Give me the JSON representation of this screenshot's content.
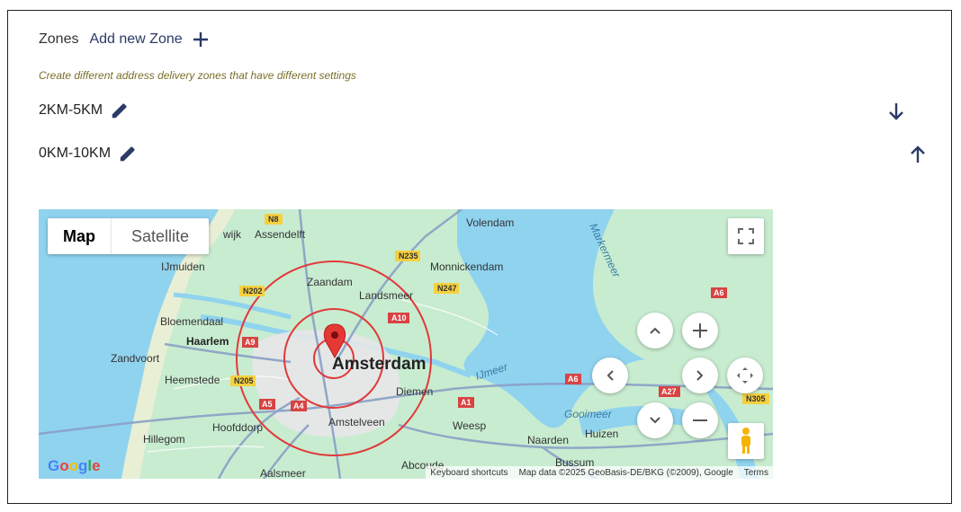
{
  "zones": {
    "title": "Zones",
    "add_label": "Add new Zone",
    "hint": "Create different address delivery zones that have different settings",
    "items": [
      {
        "name": "2KM-5KM",
        "arrow": "arrow-down-icon"
      },
      {
        "name": "0KM-10KM",
        "arrow": "arrow-up-icon"
      }
    ]
  },
  "map": {
    "type_control": {
      "map_label": "Map",
      "satellite_label": "Satellite",
      "selected": "Map"
    },
    "city_label": "Amsterdam",
    "place_labels": [
      "Assendelft",
      "Volendam",
      "IJmuiden",
      "Zaandam",
      "Monnickendam",
      "Landsmeer",
      "Bloemendaal",
      "Haarlem",
      "Zandvoort",
      "Heemstede",
      "Diemen",
      "Amstelveen",
      "Weesp",
      "Hoofddorp",
      "Hillegom",
      "Naarden",
      "Huizen",
      "Abcoude",
      "Bussum",
      "Aalsmeer",
      "IJmeer",
      "Gooimeer",
      "Markermeer",
      "wijk"
    ],
    "road_badges": [
      "N8",
      "N235",
      "N202",
      "N247",
      "A10",
      "A9",
      "N205",
      "A5",
      "A4",
      "A1",
      "A6",
      "A27",
      "N305",
      "A6"
    ],
    "attribution": {
      "shortcuts": "Keyboard shortcuts",
      "data": "Map data ©2025 GeoBasis-DE/BKG (©2009), Google",
      "terms": "Terms"
    },
    "logo": "Google",
    "icons": [
      "fullscreen-icon",
      "pan-up-icon",
      "pan-left-icon",
      "pan-right-icon",
      "pan-down-icon",
      "recenter-icon",
      "zoom-in-icon",
      "zoom-out-icon",
      "pegman-icon",
      "map-marker-icon"
    ],
    "colors": {
      "water": "#8fd3ef",
      "land": "#c8ecd0",
      "circle": "#e03a3a",
      "accent": "#2b3a67",
      "marker": "#e53935"
    }
  }
}
